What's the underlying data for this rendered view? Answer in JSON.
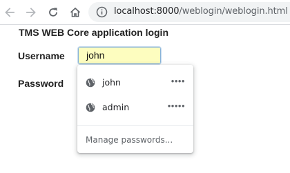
{
  "browser": {
    "url_host": "localhost:8000",
    "url_path": "/weblogin/weblogin.html",
    "icons": [
      "back-arrow-icon",
      "forward-arrow-icon",
      "reload-icon",
      "home-icon",
      "info-icon"
    ]
  },
  "page": {
    "title": "TMS WEB Core application login",
    "username_label": "Username",
    "password_label": "Password",
    "username_value": "john"
  },
  "autofill": {
    "suggestions": [
      {
        "username": "john",
        "masked_password": "••••"
      },
      {
        "username": "admin",
        "masked_password": "•••••"
      }
    ],
    "manage_label": "Manage passwords..."
  },
  "colors": {
    "input_background": "#fdfdbf",
    "input_focus_border": "#87b2d9"
  }
}
